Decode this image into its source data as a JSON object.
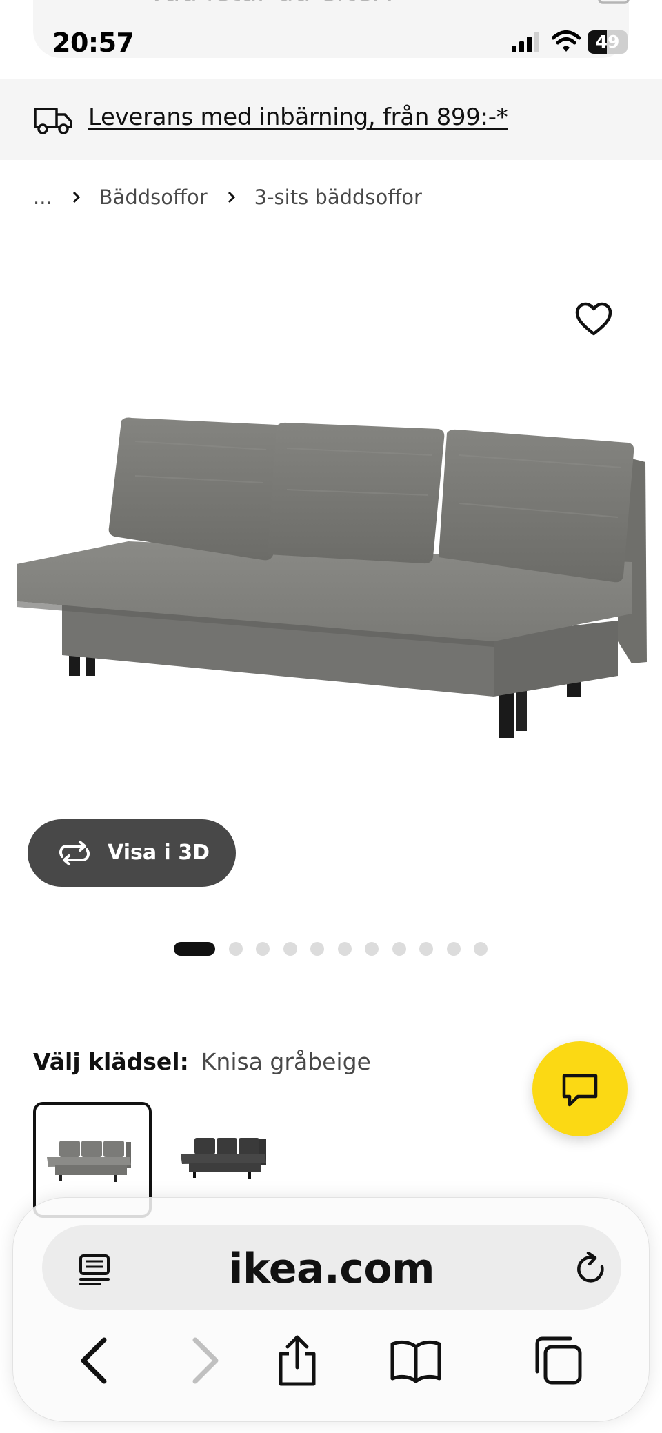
{
  "status_bar": {
    "time": "20:57",
    "battery": "49",
    "battery_level": 0.49
  },
  "search": {
    "placeholder": "Vad letar du efter?"
  },
  "delivery_banner": {
    "text": "Leverans med inbärning, från 899:-*"
  },
  "breadcrumb": {
    "items": [
      "...",
      "Bäddsoffor",
      "3-sits bäddsoffor"
    ]
  },
  "product": {
    "view_3d_label": "Visa i 3D",
    "carousel": {
      "total": 11,
      "active": 1
    }
  },
  "variant": {
    "label": "Välj klädsel:",
    "selected_value": "Knisa gråbeige",
    "options": [
      {
        "name": "Knisa gråbeige",
        "color": "#7b7b7b",
        "selected": true
      },
      {
        "name": "dark grey",
        "color": "#3d3d3d",
        "selected": false
      }
    ]
  },
  "browser": {
    "url": "ikea.com"
  },
  "colors": {
    "brand_yellow": "#fbd914",
    "dark_button": "#484848",
    "banner_bg": "#f5f5f5"
  },
  "icons": [
    "search-icon",
    "camera-icon",
    "truck-icon",
    "heart-icon",
    "rotate-3d-icon",
    "chat-icon",
    "reader-icon",
    "reload-icon",
    "back-icon",
    "forward-icon",
    "share-icon",
    "bookmarks-icon",
    "tabs-icon"
  ]
}
